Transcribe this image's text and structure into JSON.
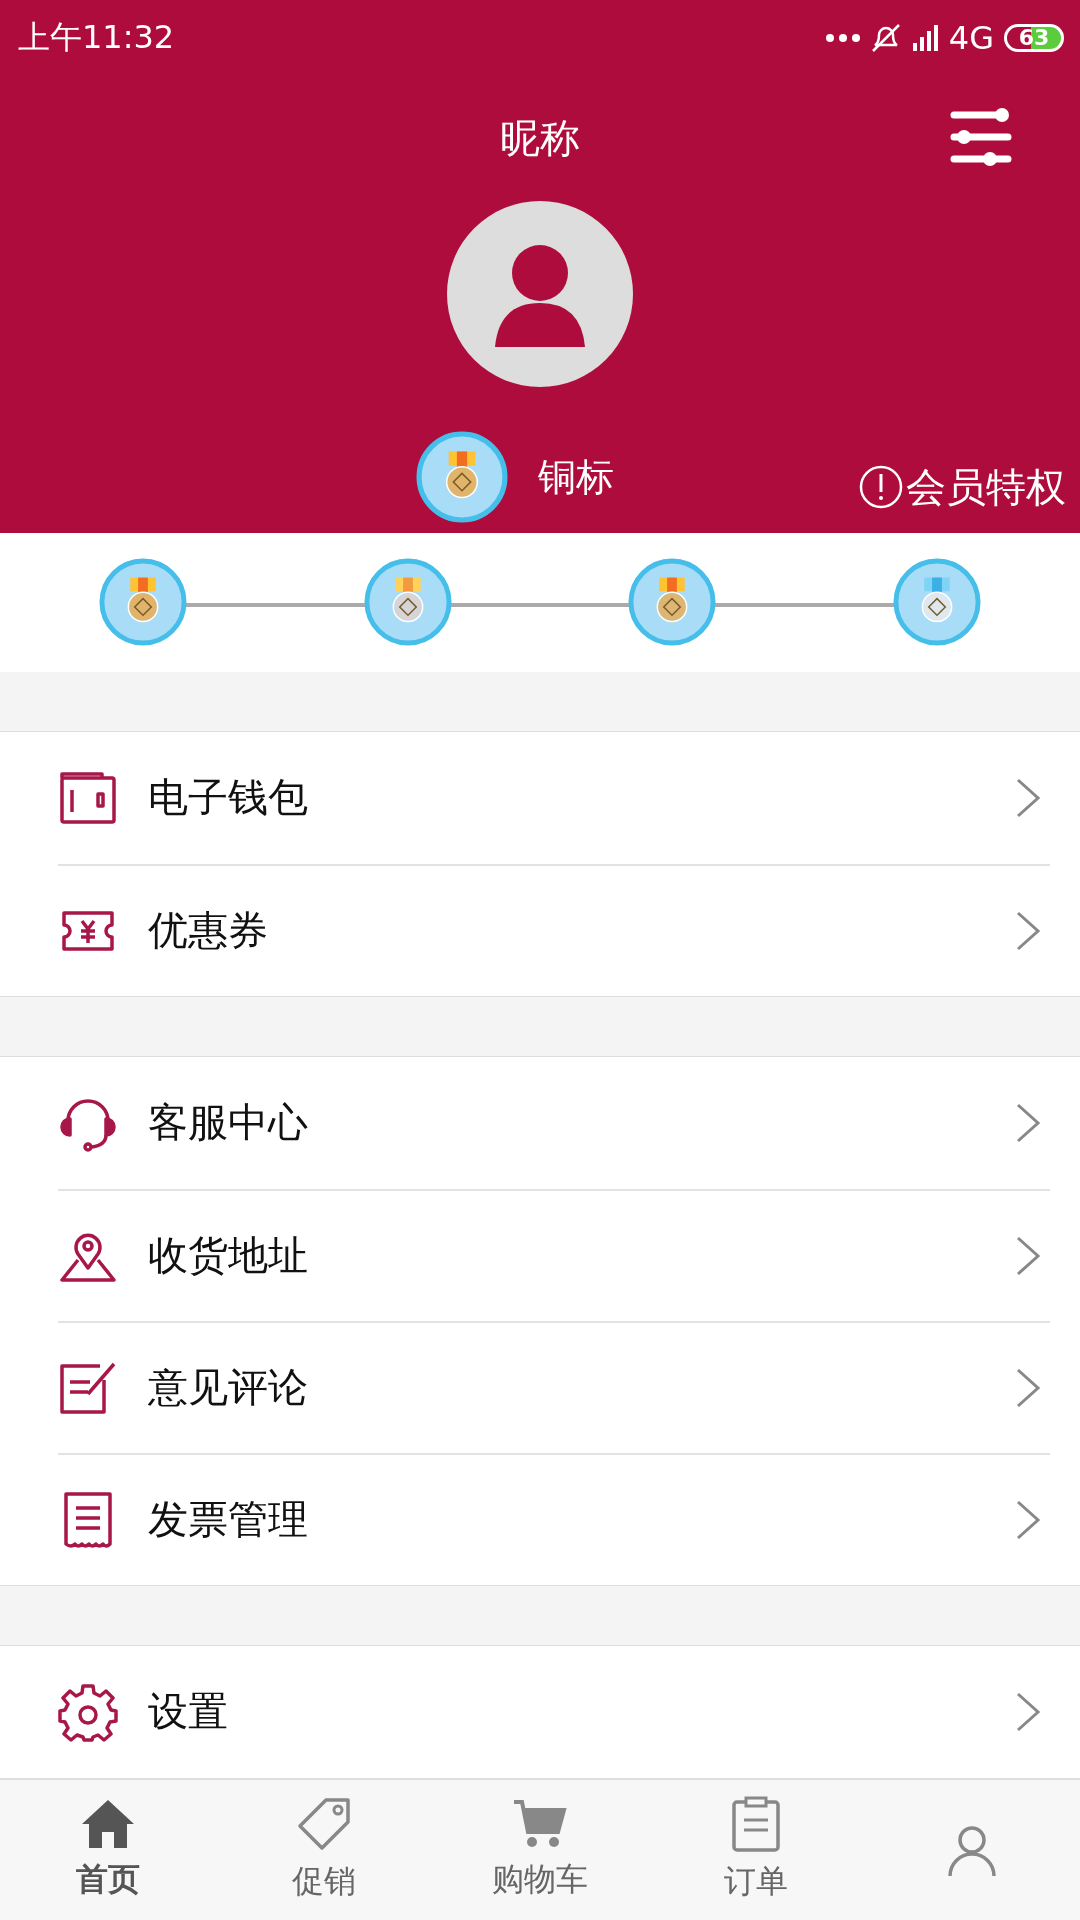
{
  "status_bar": {
    "time": "上午11:32",
    "network": "4G",
    "battery": "63"
  },
  "header": {
    "title": "昵称",
    "level_name": "铜标",
    "privilege_link": "会员特权"
  },
  "menu_groups": [
    [
      {
        "label": "电子钱包"
      },
      {
        "label": "优惠券"
      }
    ],
    [
      {
        "label": "客服中心"
      },
      {
        "label": "收货地址"
      },
      {
        "label": "意见评论"
      },
      {
        "label": "发票管理"
      }
    ],
    [
      {
        "label": "设置"
      }
    ]
  ],
  "tab_bar": [
    {
      "label": "首页",
      "selected": true
    },
    {
      "label": "促销",
      "selected": false
    },
    {
      "label": "购物车",
      "selected": false
    },
    {
      "label": "订单",
      "selected": false
    },
    {
      "selected": false
    }
  ]
}
